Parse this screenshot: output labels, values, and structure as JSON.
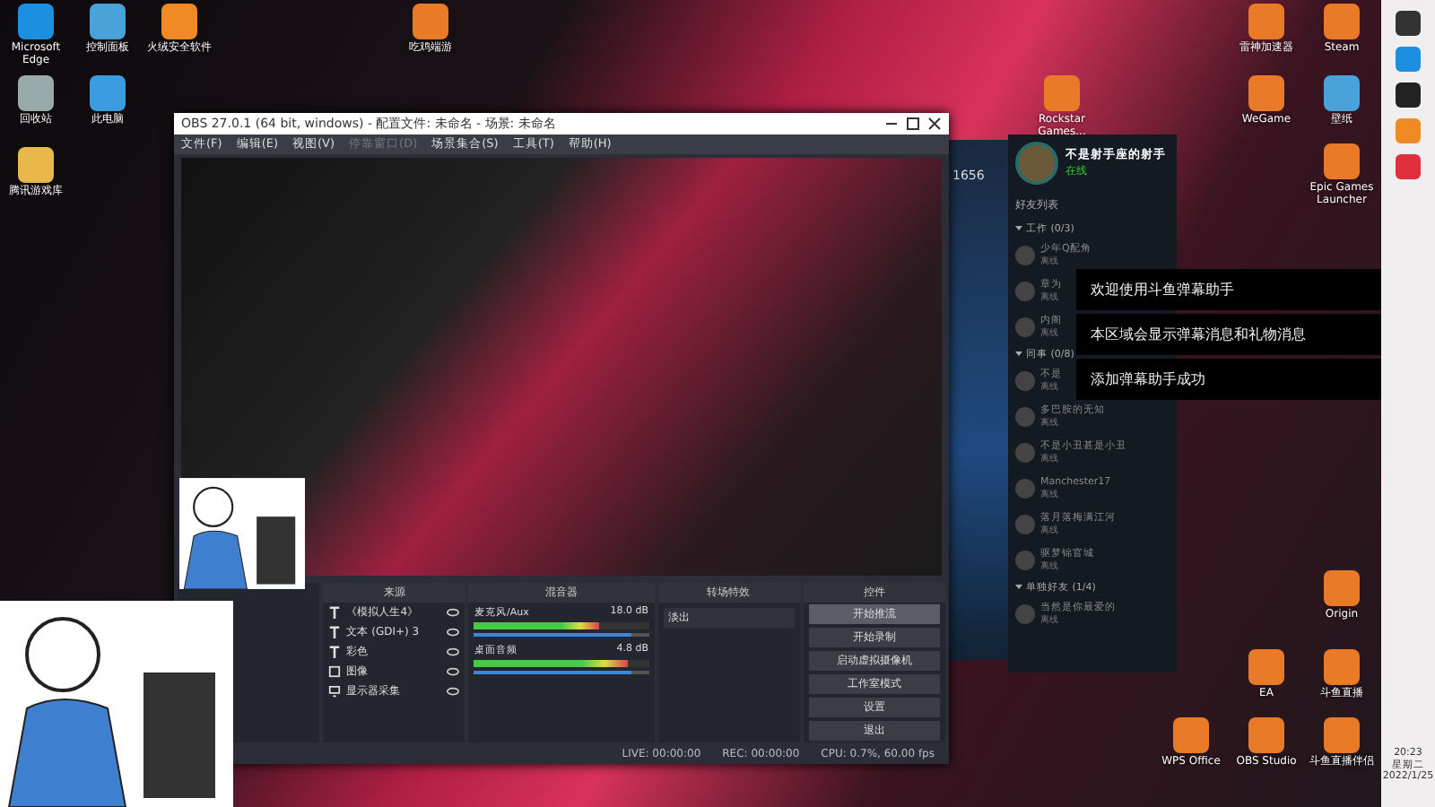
{
  "desktop_icons": [
    {
      "label": "Microsoft Edge",
      "kind": "edge"
    },
    {
      "label": "控制面板",
      "kind": "panel"
    },
    {
      "label": "火绒安全软件",
      "kind": "shield"
    },
    {
      "label": "吃鸡端游",
      "kind": "game"
    },
    {
      "label": "雷神加速器",
      "kind": "game"
    },
    {
      "label": "Steam",
      "kind": "game"
    },
    {
      "label": "回收站",
      "kind": "bin"
    },
    {
      "label": "此电脑",
      "kind": "pc"
    },
    {
      "label": "Rockstar Games...",
      "kind": "game"
    },
    {
      "label": "WeGame",
      "kind": "game"
    },
    {
      "label": "壁纸",
      "kind": "panel"
    },
    {
      "label": "腾讯游戏库",
      "kind": "folder"
    },
    {
      "label": "Epic Games Launcher",
      "kind": "game"
    },
    {
      "label": "Origin",
      "kind": "game"
    },
    {
      "label": "EA",
      "kind": "game"
    },
    {
      "label": "斗鱼直播",
      "kind": "game"
    },
    {
      "label": "WPS Office",
      "kind": "game"
    },
    {
      "label": "OBS Studio",
      "kind": "game"
    },
    {
      "label": "斗鱼直播伴侣",
      "kind": "game"
    }
  ],
  "obs": {
    "title": "OBS 27.0.1 (64 bit, windows) - 配置文件: 未命名 - 场景: 未命名",
    "menu": [
      {
        "label": "文件(F)",
        "disabled": false
      },
      {
        "label": "编辑(E)",
        "disabled": false
      },
      {
        "label": "视图(V)",
        "disabled": false
      },
      {
        "label": "停靠窗口(D)",
        "disabled": true
      },
      {
        "label": "场景集合(S)",
        "disabled": false
      },
      {
        "label": "工具(T)",
        "disabled": false
      },
      {
        "label": "帮助(H)",
        "disabled": false
      }
    ],
    "docks": [
      "来源",
      "混音器",
      "转场特效",
      "控件"
    ],
    "sources": [
      {
        "name": "《模拟人生4》",
        "kind": "text"
      },
      {
        "name": "文本 (GDI+) 3",
        "kind": "text"
      },
      {
        "name": "彩色",
        "kind": "text"
      },
      {
        "name": "图像",
        "kind": "image"
      },
      {
        "name": "显示器采集",
        "kind": "display"
      }
    ],
    "mixer": [
      {
        "name": "麦克风/Aux",
        "reading": "18.0 dB",
        "level": 0.72,
        "volume": {
          "level": 0.9
        }
      },
      {
        "name": "桌面音频",
        "reading": "4.8 dB",
        "level": 0.88,
        "volume": {
          "level": 0.9
        }
      }
    ],
    "transition": "淡出",
    "controls": [
      {
        "label": "开始推流",
        "selected": true
      },
      {
        "label": "开始录制",
        "selected": false
      },
      {
        "label": "启动虚拟摄像机",
        "selected": false
      },
      {
        "label": "工作室模式",
        "selected": false
      },
      {
        "label": "设置",
        "selected": false
      },
      {
        "label": "退出",
        "selected": false
      }
    ],
    "status": [
      "LIVE: 00:00:00",
      "REC: 00:00:00",
      "CPU: 0.7%, 60.00 fps"
    ]
  },
  "friends": {
    "name": "不是射手座的射手",
    "status": "在线",
    "heading": "好友列表",
    "groups": [
      {
        "title": "工作 (0/3)",
        "expanded": true,
        "children": [
          {
            "name": "少年Q配角",
            "status": "离线"
          },
          {
            "name": "章为",
            "status": "离线"
          },
          {
            "name": "内阁",
            "status": "离线"
          }
        ]
      },
      {
        "title": "同事 (0/8)",
        "expanded": true,
        "children": [
          {
            "name": "不是",
            "status": "离线"
          },
          {
            "name": "多巴胺的无知",
            "status": "离线"
          },
          {
            "name": "不是小丑甚是小丑",
            "status": "离线"
          },
          {
            "name": "Manchester17",
            "status": "离线"
          },
          {
            "name": "落月落梅满江河",
            "status": "离线"
          },
          {
            "name": "驱梦锦官城",
            "status": "离线"
          }
        ]
      },
      {
        "title": "单独好友 (1/4)",
        "expanded": true,
        "children": [
          {
            "name": "当然是你最爱的",
            "status": "离线"
          }
        ]
      }
    ]
  },
  "game_panel": {
    "number": "1656"
  },
  "notifications": [
    "欢迎使用斗鱼弹幕助手",
    "本区域会显示弹幕消息和礼物消息",
    "添加弹幕助手成功"
  ],
  "clock": {
    "time": "20:23",
    "weekday": "星期二",
    "date": "2022/1/25"
  }
}
